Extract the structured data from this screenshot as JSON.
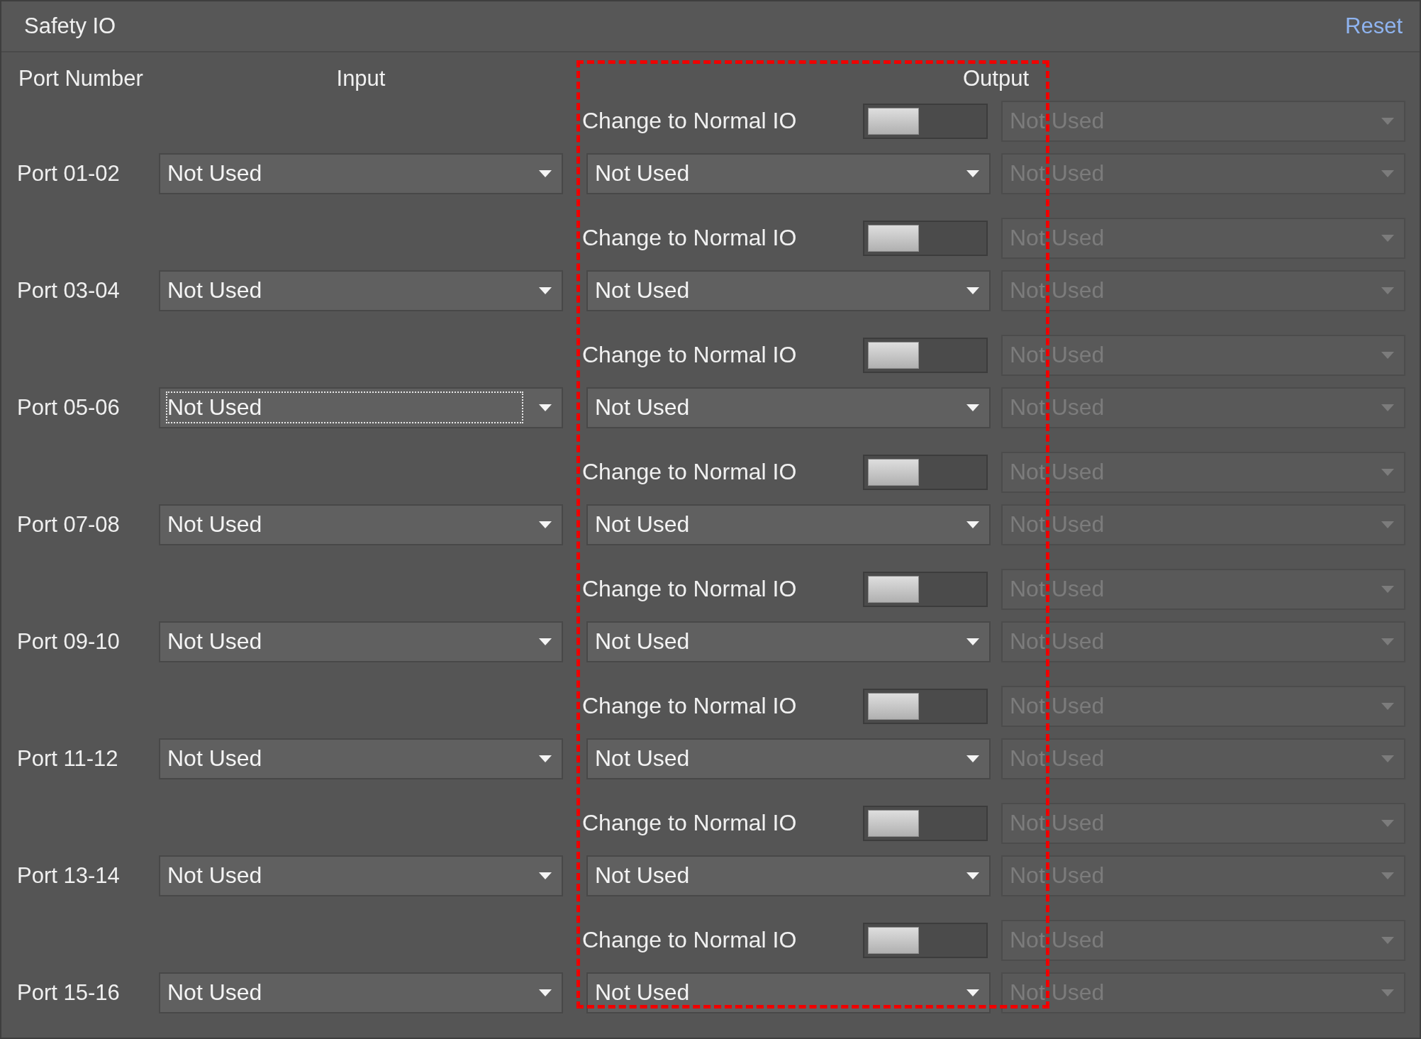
{
  "window": {
    "title": "Safety IO",
    "reset_link": "Reset"
  },
  "headers": {
    "port_number": "Port Number",
    "input": "Input",
    "output": "Output"
  },
  "ports": [
    {
      "port": "Port 01-02",
      "input": {
        "value": "Not Used",
        "focused": false
      },
      "toggle": {
        "label": "Change to Normal IO",
        "on": false
      },
      "output": {
        "value": "Not Used"
      },
      "output_2": [
        {
          "value": "Not Used",
          "disabled": true
        },
        {
          "value": "Not Used",
          "disabled": true
        }
      ]
    },
    {
      "port": "Port 03-04",
      "input": {
        "value": "Not Used",
        "focused": false
      },
      "toggle": {
        "label": "Change to Normal IO",
        "on": false
      },
      "output": {
        "value": "Not Used"
      },
      "output_2": [
        {
          "value": "Not Used",
          "disabled": true
        },
        {
          "value": "Not Used",
          "disabled": true
        }
      ]
    },
    {
      "port": "Port 05-06",
      "input": {
        "value": "Not Used",
        "focused": true
      },
      "toggle": {
        "label": "Change to Normal IO",
        "on": false
      },
      "output": {
        "value": "Not Used"
      },
      "output_2": [
        {
          "value": "Not Used",
          "disabled": true
        },
        {
          "value": "Not Used",
          "disabled": true
        }
      ]
    },
    {
      "port": "Port 07-08",
      "input": {
        "value": "Not Used",
        "focused": false
      },
      "toggle": {
        "label": "Change to Normal IO",
        "on": false
      },
      "output": {
        "value": "Not Used"
      },
      "output_2": [
        {
          "value": "Not Used",
          "disabled": true
        },
        {
          "value": "Not Used",
          "disabled": true
        }
      ]
    },
    {
      "port": "Port 09-10",
      "input": {
        "value": "Not Used",
        "focused": false
      },
      "toggle": {
        "label": "Change to Normal IO",
        "on": false
      },
      "output": {
        "value": "Not Used"
      },
      "output_2": [
        {
          "value": "Not Used",
          "disabled": true
        },
        {
          "value": "Not Used",
          "disabled": true
        }
      ]
    },
    {
      "port": "Port 11-12",
      "input": {
        "value": "Not Used",
        "focused": false
      },
      "toggle": {
        "label": "Change to Normal IO",
        "on": false
      },
      "output": {
        "value": "Not Used"
      },
      "output_2": [
        {
          "value": "Not Used",
          "disabled": true
        },
        {
          "value": "Not Used",
          "disabled": true
        }
      ]
    },
    {
      "port": "Port 13-14",
      "input": {
        "value": "Not Used",
        "focused": false
      },
      "toggle": {
        "label": "Change to Normal IO",
        "on": false
      },
      "output": {
        "value": "Not Used"
      },
      "output_2": [
        {
          "value": "Not Used",
          "disabled": true
        },
        {
          "value": "Not Used",
          "disabled": true
        }
      ]
    },
    {
      "port": "Port 15-16",
      "input": {
        "value": "Not Used",
        "focused": false
      },
      "toggle": {
        "label": "Change to Normal IO",
        "on": false
      },
      "output": {
        "value": "Not Used"
      },
      "output_2": [
        {
          "value": "Not Used",
          "disabled": true
        },
        {
          "value": "Not Used",
          "disabled": true
        }
      ]
    }
  ]
}
